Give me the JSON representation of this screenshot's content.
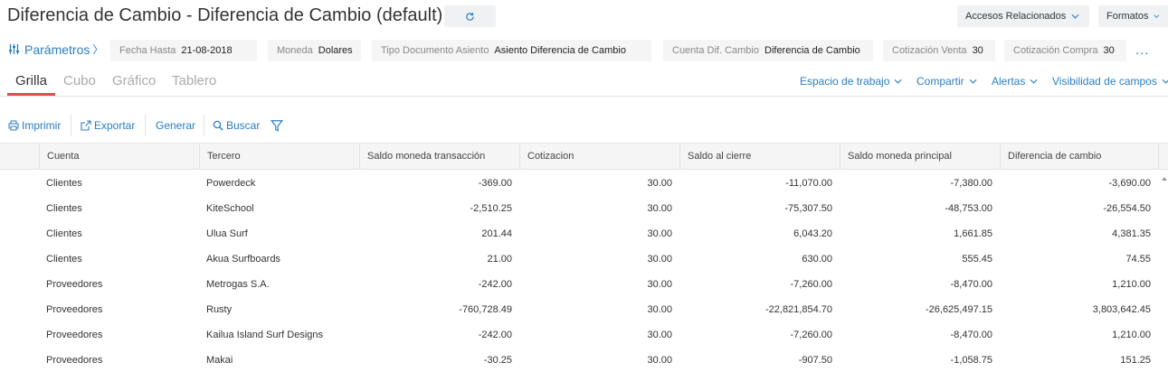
{
  "header": {
    "title": "Diferencia de Cambio - Diferencia de Cambio (default)",
    "accesos_label": "Accesos Relacionados",
    "formatos_label": "Formatos"
  },
  "params": {
    "link_label": "Parámetros",
    "link_arrow": "〉",
    "items": [
      {
        "label": "Fecha Hasta",
        "value": "21-08-2018"
      },
      {
        "label": "Moneda",
        "value": "Dolares"
      },
      {
        "label": "Tipo Documento Asiento",
        "value": "Asiento Diferencia de Cambio"
      },
      {
        "label": "Cuenta Dif. Cambio",
        "value": "Diferencia de Cambio"
      },
      {
        "label": "Cotización Venta",
        "value": "30"
      },
      {
        "label": "Cotización Compra",
        "value": "30"
      }
    ],
    "more": "..."
  },
  "tabs": [
    {
      "label": "Grilla",
      "active": true
    },
    {
      "label": "Cubo",
      "active": false
    },
    {
      "label": "Gráfico",
      "active": false
    },
    {
      "label": "Tablero",
      "active": false
    }
  ],
  "view_actions": [
    {
      "label": "Espacio de trabajo"
    },
    {
      "label": "Compartir"
    },
    {
      "label": "Alertas"
    },
    {
      "label": "Visibilidad de campos"
    }
  ],
  "toolbar": {
    "print_label": "Imprimir",
    "export_label": "Exportar",
    "generate_label": "Generar",
    "search_label": "Buscar"
  },
  "grid": {
    "columns": [
      "Cuenta",
      "Tercero",
      "Saldo moneda transacción",
      "Cotizacion",
      "Saldo al cierre",
      "Saldo moneda principal",
      "Diferencia de cambio"
    ],
    "rows": [
      [
        "Clientes",
        "Powerdeck",
        "-369.00",
        "30.00",
        "-11,070.00",
        "-7,380.00",
        "-3,690.00"
      ],
      [
        "Clientes",
        "KiteSchool",
        "-2,510.25",
        "30.00",
        "-75,307.50",
        "-48,753.00",
        "-26,554.50"
      ],
      [
        "Clientes",
        "Ulua Surf",
        "201.44",
        "30.00",
        "6,043.20",
        "1,661.85",
        "4,381.35"
      ],
      [
        "Clientes",
        "Akua Surfboards",
        "21.00",
        "30.00",
        "630.00",
        "555.45",
        "74.55"
      ],
      [
        "Proveedores",
        "Metrogas S.A.",
        "-242.00",
        "30.00",
        "-7,260.00",
        "-8,470.00",
        "1,210.00"
      ],
      [
        "Proveedores",
        "Rusty",
        "-760,728.49",
        "30.00",
        "-22,821,854.70",
        "-26,625,497.15",
        "3,803,642.45"
      ],
      [
        "Proveedores",
        "Kailua Island Surf Designs",
        "-242.00",
        "30.00",
        "-7,260.00",
        "-8,470.00",
        "1,210.00"
      ],
      [
        "Proveedores",
        "Makai",
        "-30.25",
        "30.00",
        "-907.50",
        "-1,058.75",
        "151.25"
      ]
    ]
  },
  "colors": {
    "link": "#2a7ec2",
    "active_tab_underline": "#d9534f",
    "header_bg": "#f5f5f6"
  }
}
